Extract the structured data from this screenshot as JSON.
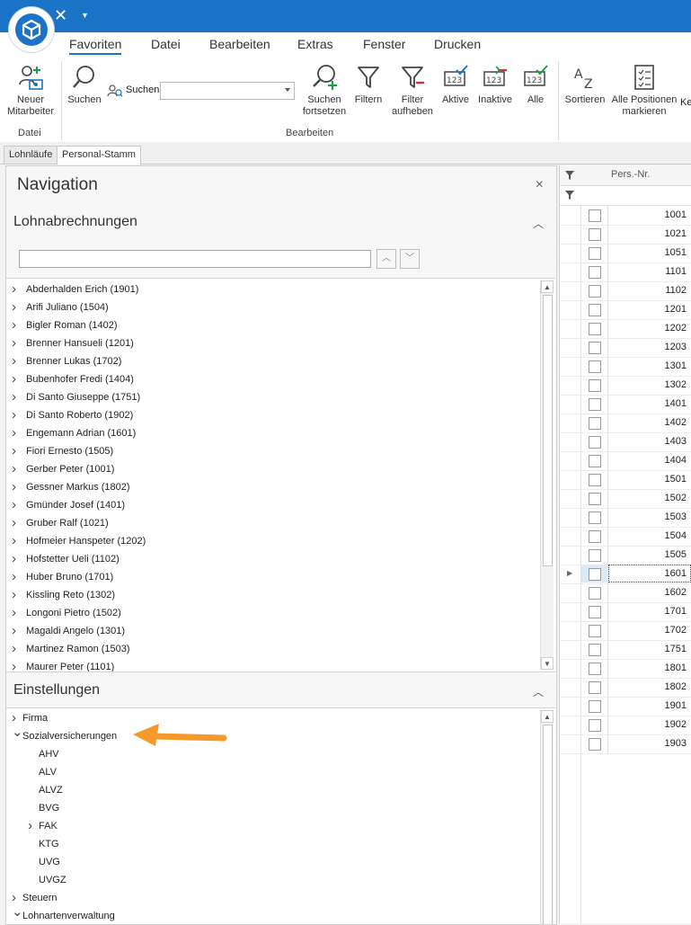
{
  "menu": {
    "items": [
      {
        "label": "Favoriten",
        "active": true
      },
      {
        "label": "Datei"
      },
      {
        "label": "Bearbeiten"
      },
      {
        "label": "Extras"
      },
      {
        "label": "Fenster"
      },
      {
        "label": "Drucken"
      }
    ]
  },
  "ribbon": {
    "new_employee": "Neuer\nMitarbeiter",
    "search": "Suchen",
    "search_label": "Suchen",
    "search_value": "",
    "search_continue": "Suchen\nfortsetzen",
    "filter": "Filtern",
    "filter_remove": "Filter\naufheben",
    "active": "Aktive",
    "inactive": "Inaktive",
    "all": "Alle",
    "sort": "Sortieren",
    "mark_all": "Alle Positionen\nmarkieren",
    "cut_label": "Ke",
    "group_datei": "Datei",
    "group_bearbeiten": "Bearbeiten"
  },
  "tabs": [
    {
      "label": "Lohnläufe",
      "active": false
    },
    {
      "label": "Personal-Stamm",
      "active": true
    }
  ],
  "navigation": {
    "title": "Navigation",
    "close": "×",
    "section1": "Lohnabrechnungen",
    "section2": "Einstellungen",
    "filter_value": "",
    "employees": [
      "Abderhalden Erich (1901)",
      "Arifi Juliano (1504)",
      "Bigler Roman (1402)",
      "Brenner Hansueli (1201)",
      "Brenner Lukas (1702)",
      "Bubenhofer Fredi (1404)",
      "Di Santo Giuseppe (1751)",
      "Di Santo Roberto (1902)",
      "Engemann Adrian (1601)",
      "Fiori Ernesto (1505)",
      "Gerber Peter (1001)",
      "Gessner Markus (1802)",
      "Gmünder Josef (1401)",
      "Gruber Ralf (1021)",
      "Hofmeier Hanspeter (1202)",
      "Hofstetter Ueli (1102)",
      "Huber Bruno (1701)",
      "Kissling Reto (1302)",
      "Longoni Pietro (1502)",
      "Magaldi Angelo (1301)",
      "Martinez Ramon (1503)",
      "Maurer Peter (1101)"
    ],
    "settings": [
      {
        "label": "Firma",
        "level": 0,
        "chevron": "right"
      },
      {
        "label": "Sozialversicherungen",
        "level": 0,
        "chevron": "down"
      },
      {
        "label": "AHV",
        "level": 1,
        "chevron": "none"
      },
      {
        "label": "ALV",
        "level": 1,
        "chevron": "none"
      },
      {
        "label": "ALVZ",
        "level": 1,
        "chevron": "none"
      },
      {
        "label": "BVG",
        "level": 1,
        "chevron": "none"
      },
      {
        "label": "FAK",
        "level": 1,
        "chevron": "right"
      },
      {
        "label": "KTG",
        "level": 1,
        "chevron": "none"
      },
      {
        "label": "UVG",
        "level": 1,
        "chevron": "none"
      },
      {
        "label": "UVGZ",
        "level": 1,
        "chevron": "none"
      },
      {
        "label": "Steuern",
        "level": 0,
        "chevron": "right"
      },
      {
        "label": "Lohnartenverwaltung",
        "level": 0,
        "chevron": "down"
      }
    ]
  },
  "grid": {
    "header": "Pers.-Nr.",
    "selected": "1601",
    "rows": [
      "1001",
      "1021",
      "1051",
      "1101",
      "1102",
      "1201",
      "1202",
      "1203",
      "1301",
      "1302",
      "1401",
      "1402",
      "1403",
      "1404",
      "1501",
      "1502",
      "1503",
      "1504",
      "1505",
      "1601",
      "1602",
      "1701",
      "1702",
      "1751",
      "1801",
      "1802",
      "1901",
      "1902",
      "1903"
    ]
  },
  "colors": {
    "accent": "#1a73c7",
    "annotation_arrow": "#f59a2a"
  }
}
